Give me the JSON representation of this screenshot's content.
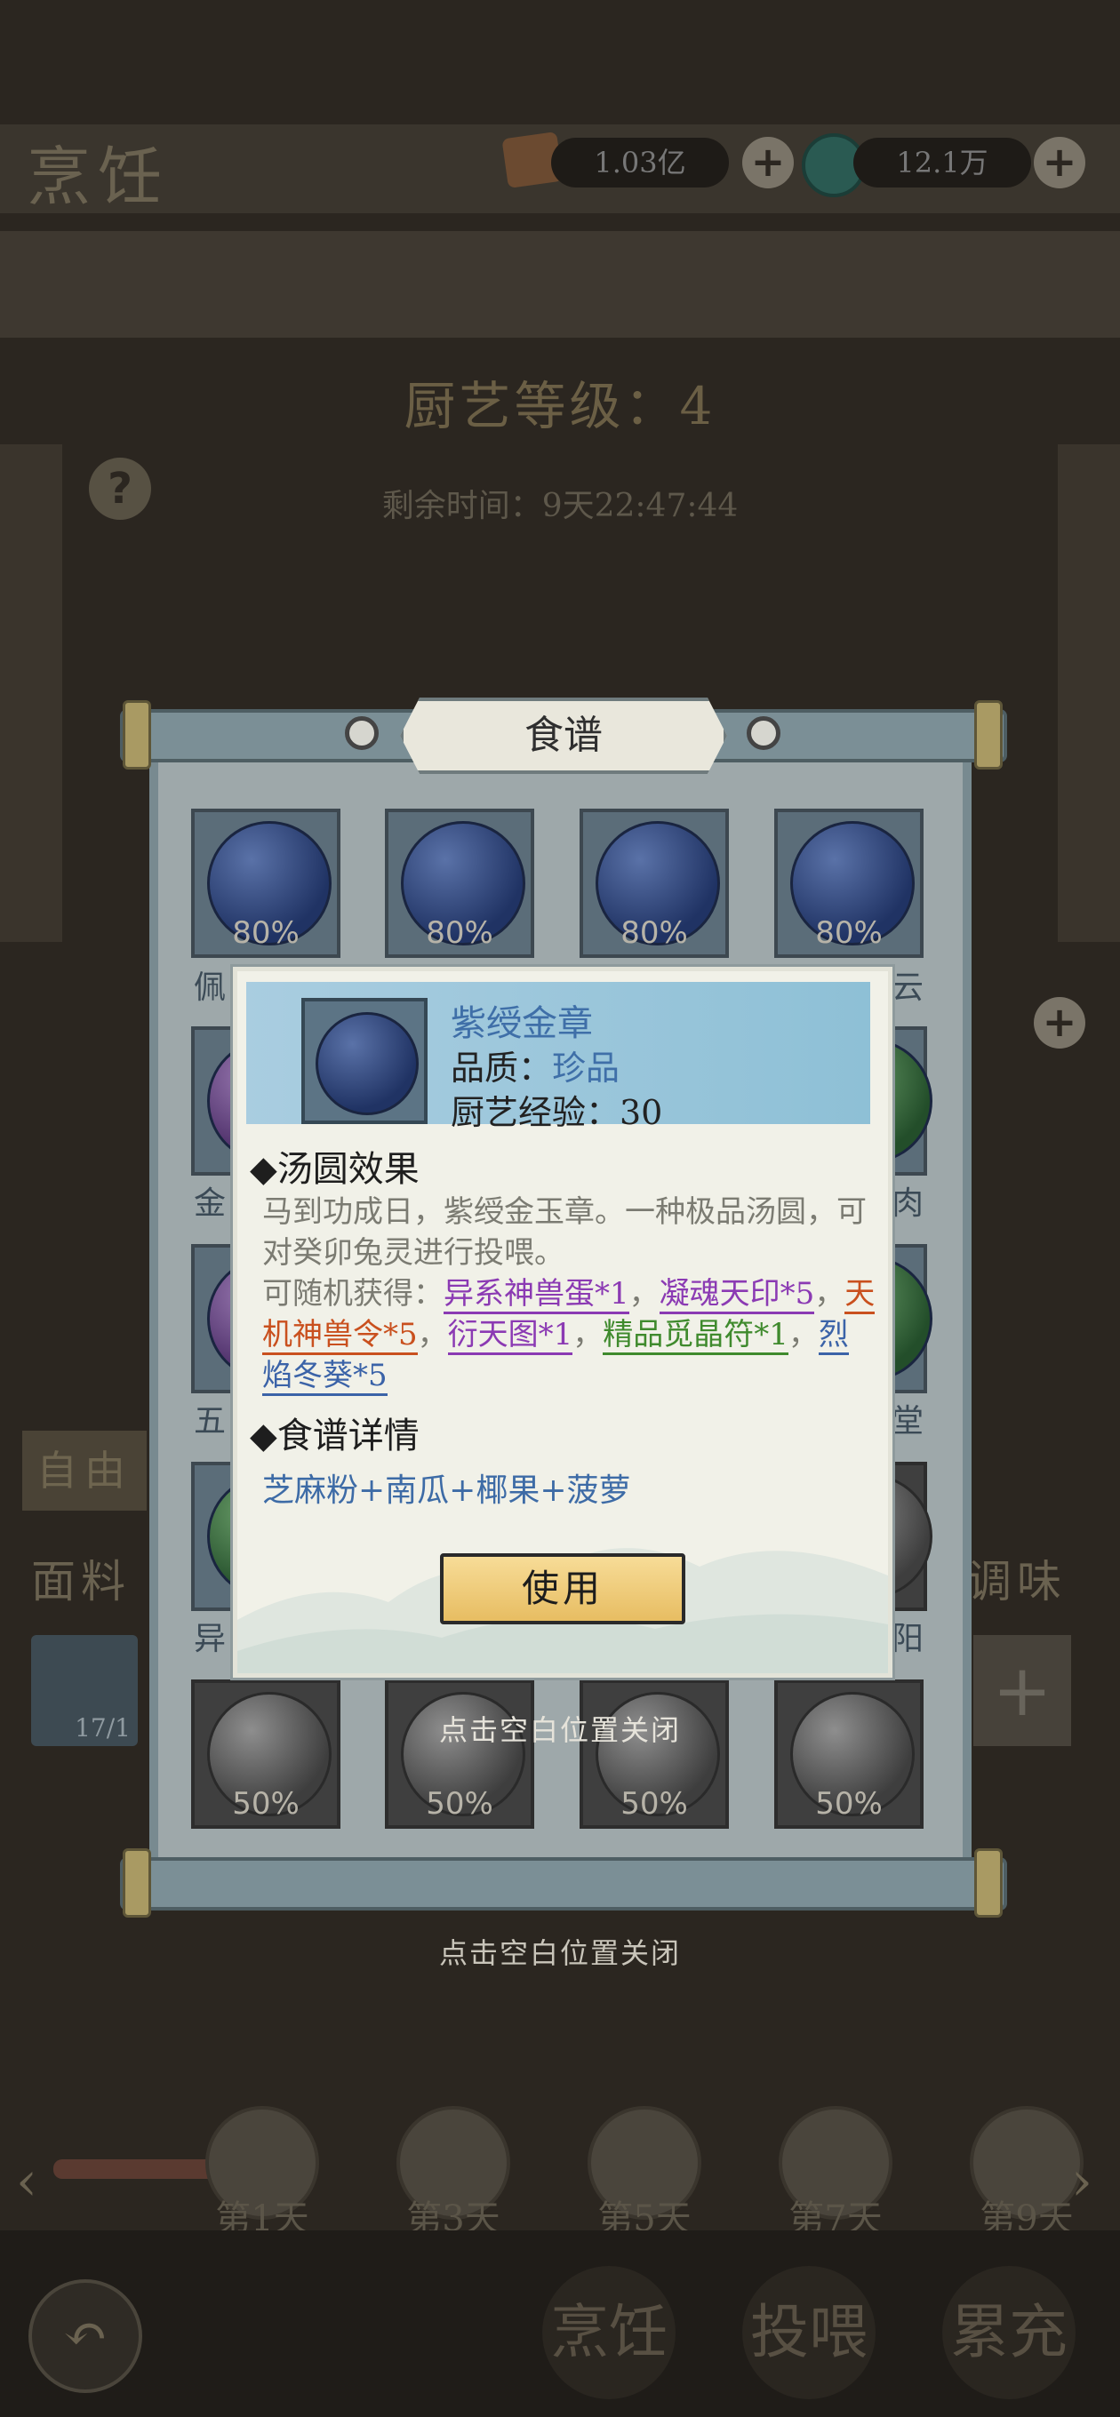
{
  "header": {
    "title": "烹饪",
    "gold_amount": "1.03亿",
    "jade_amount": "12.1万"
  },
  "cooking": {
    "level_text": "厨艺等级：4",
    "remaining_text": "剩余时间：9天22:47:44"
  },
  "background": {
    "left_tab": "自由",
    "left_category": "面料",
    "right_category": "调味",
    "slot_count": "17/1"
  },
  "recipe_panel": {
    "title": "食谱",
    "row1": [
      {
        "pct": "80%"
      },
      {
        "pct": "80%"
      },
      {
        "pct": "80%"
      },
      {
        "pct": "80%"
      }
    ],
    "row_last": [
      {
        "pct": "50%"
      },
      {
        "pct": "50%"
      },
      {
        "pct": "50%"
      },
      {
        "pct": "50%"
      }
    ],
    "left_chars": [
      "佩",
      "金",
      "五",
      "异"
    ],
    "right_chars": [
      "云",
      "肉",
      "堂",
      "阳"
    ]
  },
  "detail": {
    "name": "紫绶金章",
    "quality_label": "品质：",
    "quality_value": "珍品",
    "exp_text": "厨艺经验：30",
    "effect_heading": "◆汤圆效果",
    "effect_desc": "马到功成日，紫绶金玉章。一种极品汤圆，可对癸卯兔灵进行投喂。",
    "random_prefix": "可随机获得：",
    "rewards": [
      {
        "text": "异系神兽蛋*1",
        "color": "purple"
      },
      {
        "text": "凝魂天印*5",
        "color": "purple"
      },
      {
        "text": "天机神兽令*5",
        "color": "orange"
      },
      {
        "text": "衍天图*1",
        "color": "purple"
      },
      {
        "text": "精品觅晶符*1",
        "color": "green"
      },
      {
        "text": "烈焰冬葵*5",
        "color": "blue"
      }
    ],
    "recipe_heading": "◆食谱详情",
    "ingredients": "芝麻粉+南瓜+椰果+菠萝",
    "use_label": "使用"
  },
  "hints": {
    "close_inner": "点击空白位置关闭",
    "close_outer": "点击空白位置关闭"
  },
  "timeline": {
    "days": [
      "第1天",
      "第3天",
      "第5天",
      "第7天",
      "第9天"
    ]
  },
  "nav": {
    "cook": "烹饪",
    "feed": "投喂",
    "recharge": "累充"
  },
  "colors": {
    "accent_gold": "#e7bd62",
    "quality_blue": "#3f6fa8",
    "reward_purple": "#8b3ab3",
    "reward_orange": "#c9501e",
    "reward_green": "#3f8a2d",
    "reward_blue": "#3b63a8"
  }
}
